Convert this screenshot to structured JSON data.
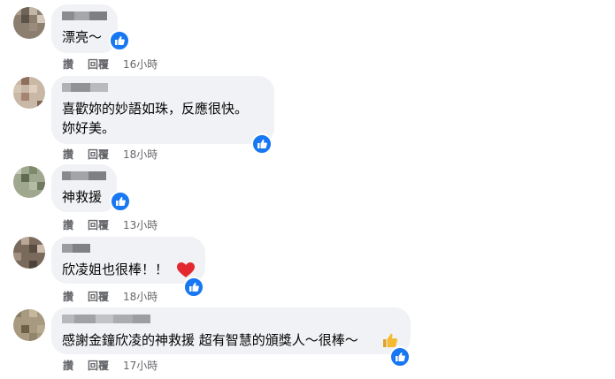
{
  "comments": [
    {
      "text": "漂亮～",
      "actions": {
        "like": "讚",
        "reply": "回覆",
        "time": "16小時"
      }
    },
    {
      "text": "喜歡妳的妙語如珠，反應很快。\n妳好美。",
      "actions": {
        "like": "讚",
        "reply": "回覆",
        "time": "18小時"
      }
    },
    {
      "text": "神救援",
      "actions": {
        "like": "讚",
        "reply": "回覆",
        "time": "13小時"
      }
    },
    {
      "text": "欣凌姐也很棒！！",
      "actions": {
        "like": "讚",
        "reply": "回覆",
        "time": "18小時"
      }
    },
    {
      "text": "感謝金鐘欣凌的神救援 超有智慧的頒獎人～很棒～",
      "actions": {
        "like": "讚",
        "reply": "回覆",
        "time": "17小時"
      }
    }
  ],
  "reactions": {
    "like_icon": "like-reaction-icon",
    "heart_icon": "heart-reaction-icon",
    "thumbs_emoji_icon": "thumbs-up-emoji-icon"
  },
  "colors": {
    "bubble": "#f0f2f5",
    "like_blue": "#1877f2",
    "meta_gray": "#65676b",
    "heart_red": "#e4282f",
    "emoji_yellow": "#f5b932"
  }
}
